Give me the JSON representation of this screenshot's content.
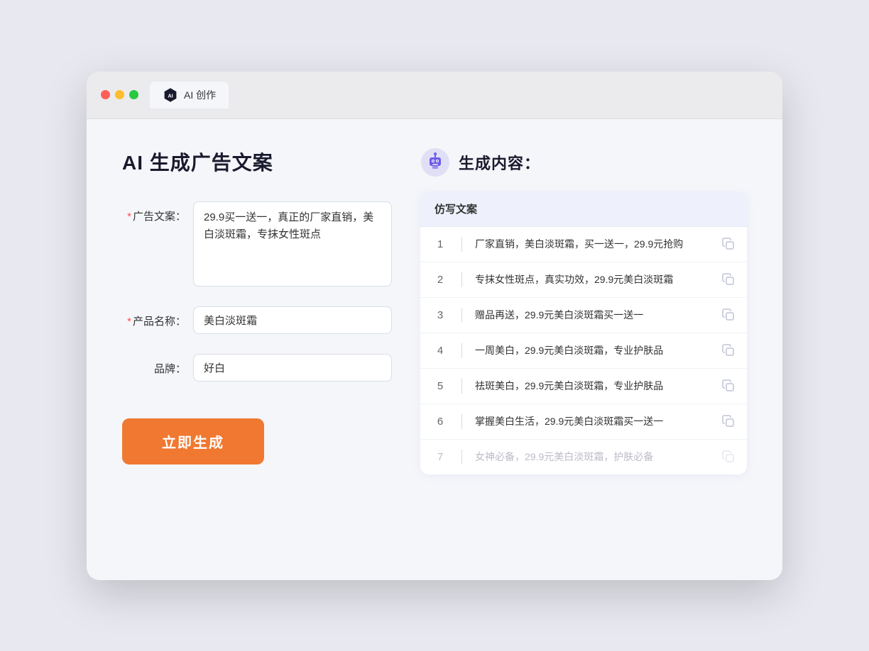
{
  "window": {
    "tab_label": "AI 创作"
  },
  "left": {
    "title": "AI 生成广告文案",
    "fields": [
      {
        "label": "广告文案：",
        "required": true,
        "type": "textarea",
        "value": "29.9买一送一，真正的厂家直销，美白淡斑霜，专抹女性斑点",
        "name": "ad-copy"
      },
      {
        "label": "产品名称：",
        "required": true,
        "type": "input",
        "value": "美白淡斑霜",
        "name": "product-name"
      },
      {
        "label": "品牌：",
        "required": false,
        "type": "input",
        "value": "好白",
        "name": "brand"
      }
    ],
    "generate_button": "立即生成"
  },
  "right": {
    "title": "生成内容：",
    "table_header": "仿写文案",
    "rows": [
      {
        "num": "1",
        "text": "厂家直销，美白淡斑霜，买一送一，29.9元抢购",
        "muted": false
      },
      {
        "num": "2",
        "text": "专抹女性斑点，真实功效，29.9元美白淡斑霜",
        "muted": false
      },
      {
        "num": "3",
        "text": "赠品再送，29.9元美白淡斑霜买一送一",
        "muted": false
      },
      {
        "num": "4",
        "text": "一周美白，29.9元美白淡斑霜，专业护肤品",
        "muted": false
      },
      {
        "num": "5",
        "text": "祛斑美白，29.9元美白淡斑霜，专业护肤品",
        "muted": false
      },
      {
        "num": "6",
        "text": "掌握美白生活，29.9元美白淡斑霜买一送一",
        "muted": false
      },
      {
        "num": "7",
        "text": "女神必备，29.9元美白淡斑霜，护肤必备",
        "muted": true
      }
    ]
  }
}
